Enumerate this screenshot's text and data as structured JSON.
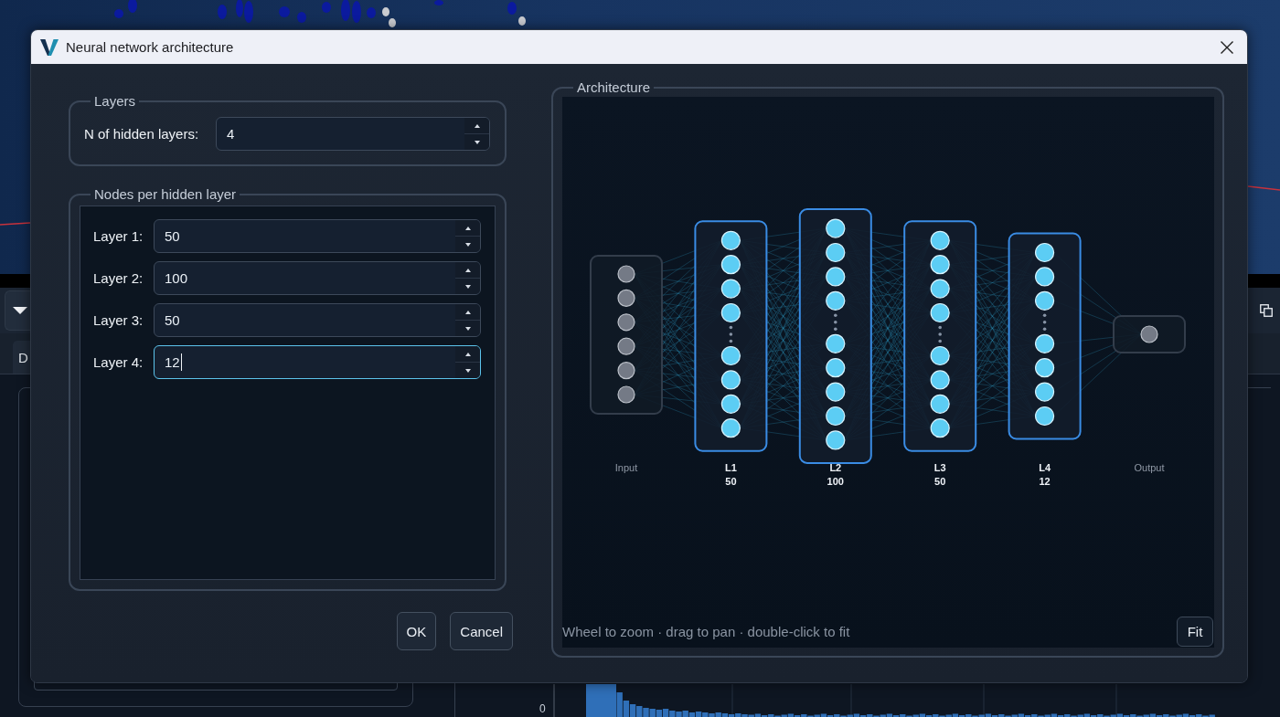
{
  "background": {
    "tab": {
      "label": "D"
    },
    "histogram": {
      "y_tick": "0"
    }
  },
  "dialog": {
    "title": "Neural network architecture",
    "layers_group": {
      "title": "Layers",
      "field": {
        "label": "N of hidden layers:",
        "value": "4",
        "focused": false
      }
    },
    "nodes_group": {
      "title": "Nodes per hidden layer",
      "fields": [
        {
          "label": "Layer 1:",
          "value": "50",
          "focused": false
        },
        {
          "label": "Layer 2:",
          "value": "100",
          "focused": false
        },
        {
          "label": "Layer 3:",
          "value": "50",
          "focused": false
        },
        {
          "label": "Layer 4:",
          "value": "12",
          "focused": true
        }
      ]
    },
    "buttons": [
      {
        "label": "OK"
      },
      {
        "label": "Cancel"
      }
    ],
    "architecture": {
      "title": "Architecture",
      "layers": [
        {
          "kind": "input",
          "label": "Input",
          "nodes": [
            {
              "kind": "unit"
            },
            {
              "kind": "unit"
            },
            {
              "kind": "unit"
            },
            {
              "kind": "unit"
            },
            {
              "kind": "unit"
            },
            {
              "kind": "unit"
            }
          ]
        },
        {
          "kind": "hidden",
          "label": "L1",
          "size": "50",
          "nodes": [
            {
              "kind": "unit"
            },
            {
              "kind": "unit"
            },
            {
              "kind": "unit"
            },
            {
              "kind": "unit"
            },
            {
              "kind": "ellipsis"
            },
            {
              "kind": "unit"
            },
            {
              "kind": "unit"
            },
            {
              "kind": "unit"
            },
            {
              "kind": "unit"
            }
          ]
        },
        {
          "kind": "hidden",
          "label": "L2",
          "size": "100",
          "nodes": [
            {
              "kind": "unit"
            },
            {
              "kind": "unit"
            },
            {
              "kind": "unit"
            },
            {
              "kind": "unit"
            },
            {
              "kind": "ellipsis"
            },
            {
              "kind": "unit"
            },
            {
              "kind": "unit"
            },
            {
              "kind": "unit"
            },
            {
              "kind": "unit"
            },
            {
              "kind": "unit"
            }
          ]
        },
        {
          "kind": "hidden",
          "label": "L3",
          "size": "50",
          "nodes": [
            {
              "kind": "unit"
            },
            {
              "kind": "unit"
            },
            {
              "kind": "unit"
            },
            {
              "kind": "unit"
            },
            {
              "kind": "ellipsis"
            },
            {
              "kind": "unit"
            },
            {
              "kind": "unit"
            },
            {
              "kind": "unit"
            },
            {
              "kind": "unit"
            }
          ]
        },
        {
          "kind": "hidden",
          "label": "L4",
          "size": "12",
          "nodes": [
            {
              "kind": "unit"
            },
            {
              "kind": "unit"
            },
            {
              "kind": "unit"
            },
            {
              "kind": "ellipsis"
            },
            {
              "kind": "unit"
            },
            {
              "kind": "unit"
            },
            {
              "kind": "unit"
            },
            {
              "kind": "unit"
            }
          ]
        },
        {
          "kind": "output",
          "label": "Output",
          "nodes": [
            {
              "kind": "unit"
            }
          ]
        }
      ],
      "hint": "Wheel to zoom · drag to pan · double-click to fit",
      "fit_button": {
        "label": "Fit"
      }
    }
  }
}
